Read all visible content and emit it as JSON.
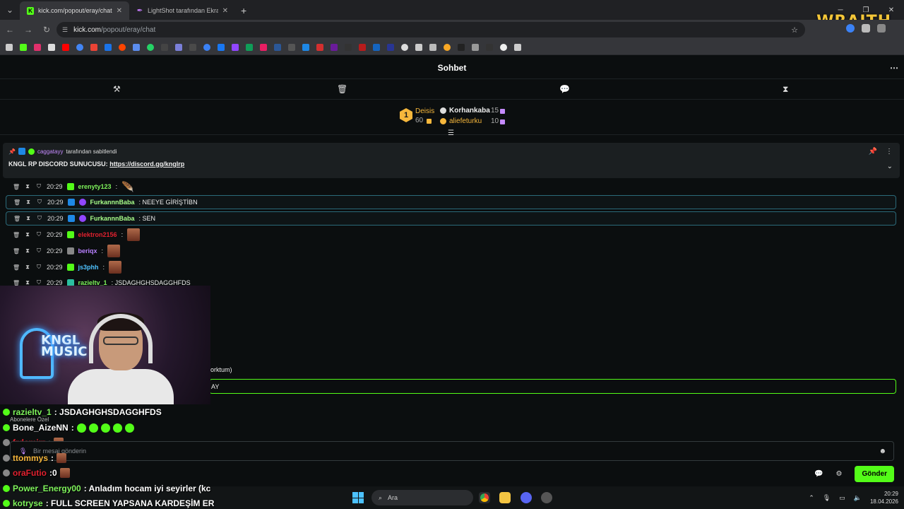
{
  "browser": {
    "tabs": [
      {
        "title": "kick.com/popout/eray/chat",
        "active": true
      },
      {
        "title": "LightShot tarafından Ekran Gör",
        "active": false
      }
    ],
    "url_domain": "kick.com",
    "url_path": "/popout/eray/chat",
    "overlay_brand": "WRAITH"
  },
  "chat": {
    "header_title": "Sohbet",
    "leaderboard": {
      "first": {
        "rank": "1",
        "name": "Deisis",
        "value": "60"
      },
      "second": {
        "name": "Korhankaba",
        "value": "15"
      },
      "third": {
        "name": "aliefeturku",
        "value": "10"
      }
    },
    "pinned": {
      "pinner": "caggatayy",
      "pinned_by_text": "tarafından sabitlendi",
      "message_prefix": "KNGL RP DISCORD SUNUCUSU:",
      "link": "https://discord.gg/knglrp"
    },
    "messages": [
      {
        "time": "20:29",
        "user": "erenyty123",
        "text": ":",
        "user_color": "#7ef35b"
      },
      {
        "time": "20:29",
        "user": "FurkannnBaba",
        "text": ": NEEYE GİRİŞTİBN",
        "user_color": "#a8ff8a"
      },
      {
        "time": "20:29",
        "user": "FurkannnBaba",
        "text": ": SEN",
        "user_color": "#a8ff8a"
      },
      {
        "time": "20:29",
        "user": "elektron2156",
        "text": ":",
        "user_color": "#e0212f"
      },
      {
        "time": "20:29",
        "user": "beriqx",
        "text": ":",
        "user_color": "#b880ff"
      },
      {
        "time": "20:29",
        "user": "js3phh",
        "text": ":",
        "user_color": "#4fc3ff"
      },
      {
        "time": "20:29",
        "user": "razieltv_1",
        "text": ": JSDAGHGHSDAGGHFDS",
        "user_color": "#7ef35b"
      }
    ],
    "partial_lines": {
      "line1": "orktum)",
      "line2": "AY"
    },
    "input_placeholder": "Bir mesaj gönderin",
    "send_label": "Gönder"
  },
  "overlay_chat": {
    "subscribers_label": "Abonelere Özel",
    "lines": [
      {
        "user": "razieltv_1",
        "text": ": JSDAGHGHSDAGGHFDS",
        "color": "#7ef35b"
      },
      {
        "user": "Bone_AizeNN",
        "text": ":",
        "color": "#ffffff"
      },
      {
        "user": "frdemirr",
        "text": ":",
        "color": "#e0212f"
      },
      {
        "user": "ttommys",
        "text": ":",
        "color": "#f6b73c"
      },
      {
        "user": "oraFutio",
        "text": ":0",
        "color": "#e0212f"
      },
      {
        "user": "Power_Energy00",
        "text": ": Anladım hocam iyi seyirler (kc",
        "color": "#7ef35b"
      },
      {
        "user": "kotryse",
        "text": ": FULL SCREEN YAPSANA KARDEŞİM ER",
        "color": "#7ef35b"
      }
    ]
  },
  "taskbar": {
    "search_label": "Ara",
    "time": "20:29",
    "date": "18.04.2026"
  }
}
